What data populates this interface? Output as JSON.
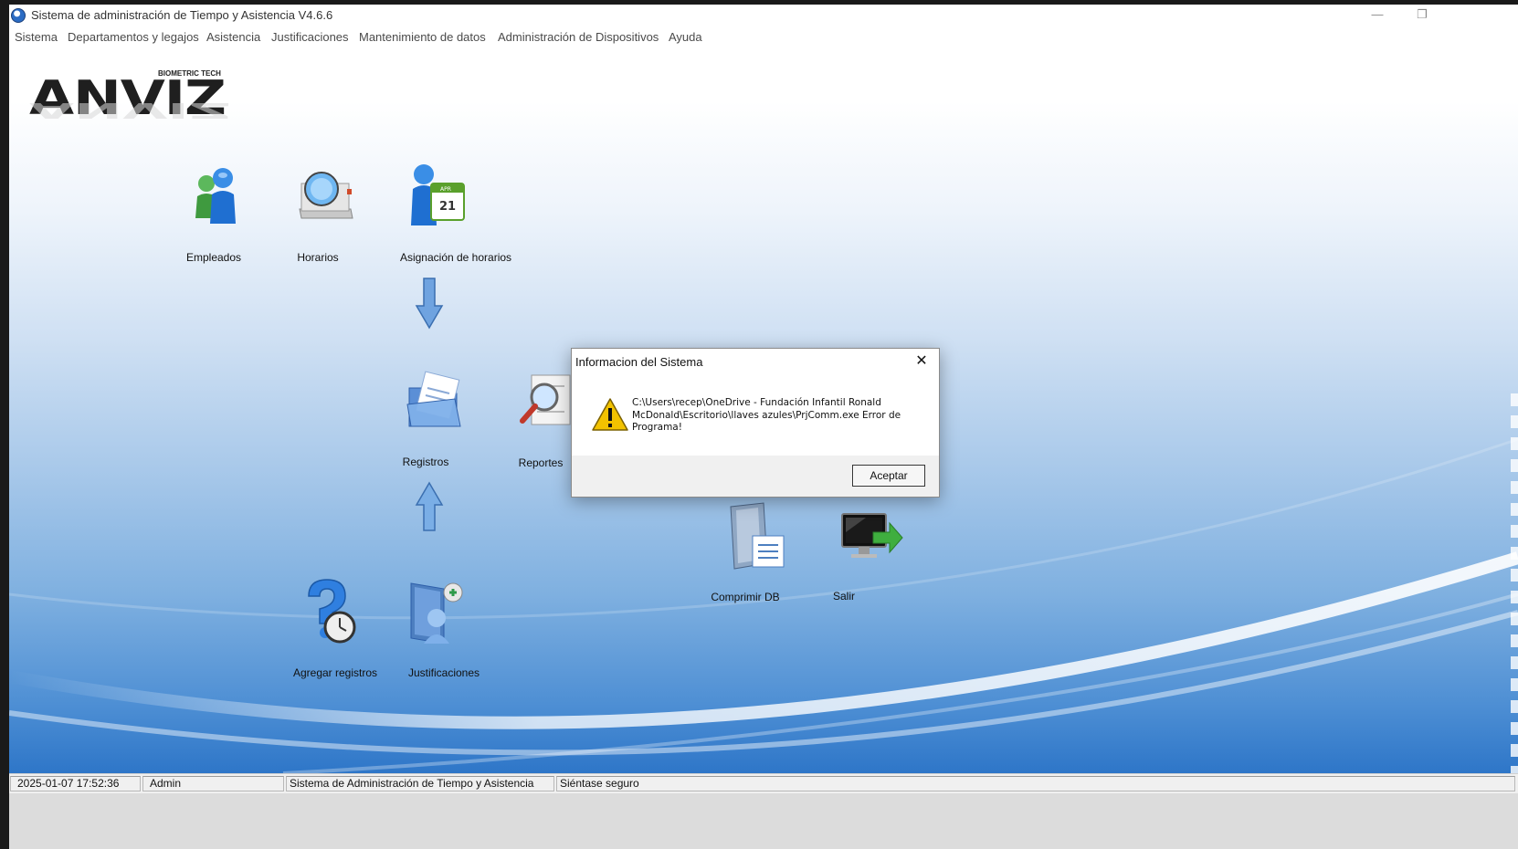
{
  "window": {
    "title": "Sistema de administración de Tiempo y Asistencia V4.6.6",
    "minimize_glyph": "—",
    "restore_glyph": "❐"
  },
  "menu": {
    "items": [
      "Sistema",
      "Departamentos y legajos",
      "Asistencia",
      "Justificaciones",
      "Mantenimiento de datos",
      "Administración de Dispositivos",
      "Ayuda"
    ]
  },
  "logo": {
    "text": "ANVIZ",
    "tagline": "BIOMETRIC TECH"
  },
  "tiles": {
    "empleados": "Empleados",
    "horarios": "Horarios",
    "asignacion": "Asignación de horarios",
    "registros": "Registros",
    "reportes": "Reportes",
    "comprimir": "Comprimir DB",
    "salir": "Salir",
    "agregar": "Agregar registros",
    "justificaciones": "Justificaciones"
  },
  "dialog": {
    "title": "Informacion del Sistema",
    "message": "C:\\Users\\recep\\OneDrive - Fundación Infantil Ronald McDonald\\Escritorio\\llaves azules\\PrjComm.exe Error de Programa!",
    "ok_label": "Aceptar",
    "close_glyph": "✕",
    "icon": "warning-icon"
  },
  "status": {
    "datetime": "2025-01-07 17:52:36",
    "user": "Admin",
    "system": "Sistema de Administración de Tiempo y Asistencia",
    "motto": "Siéntase seguro"
  },
  "colors": {
    "accent_blue": "#2e76c8",
    "warning_yellow": "#f2c200"
  }
}
